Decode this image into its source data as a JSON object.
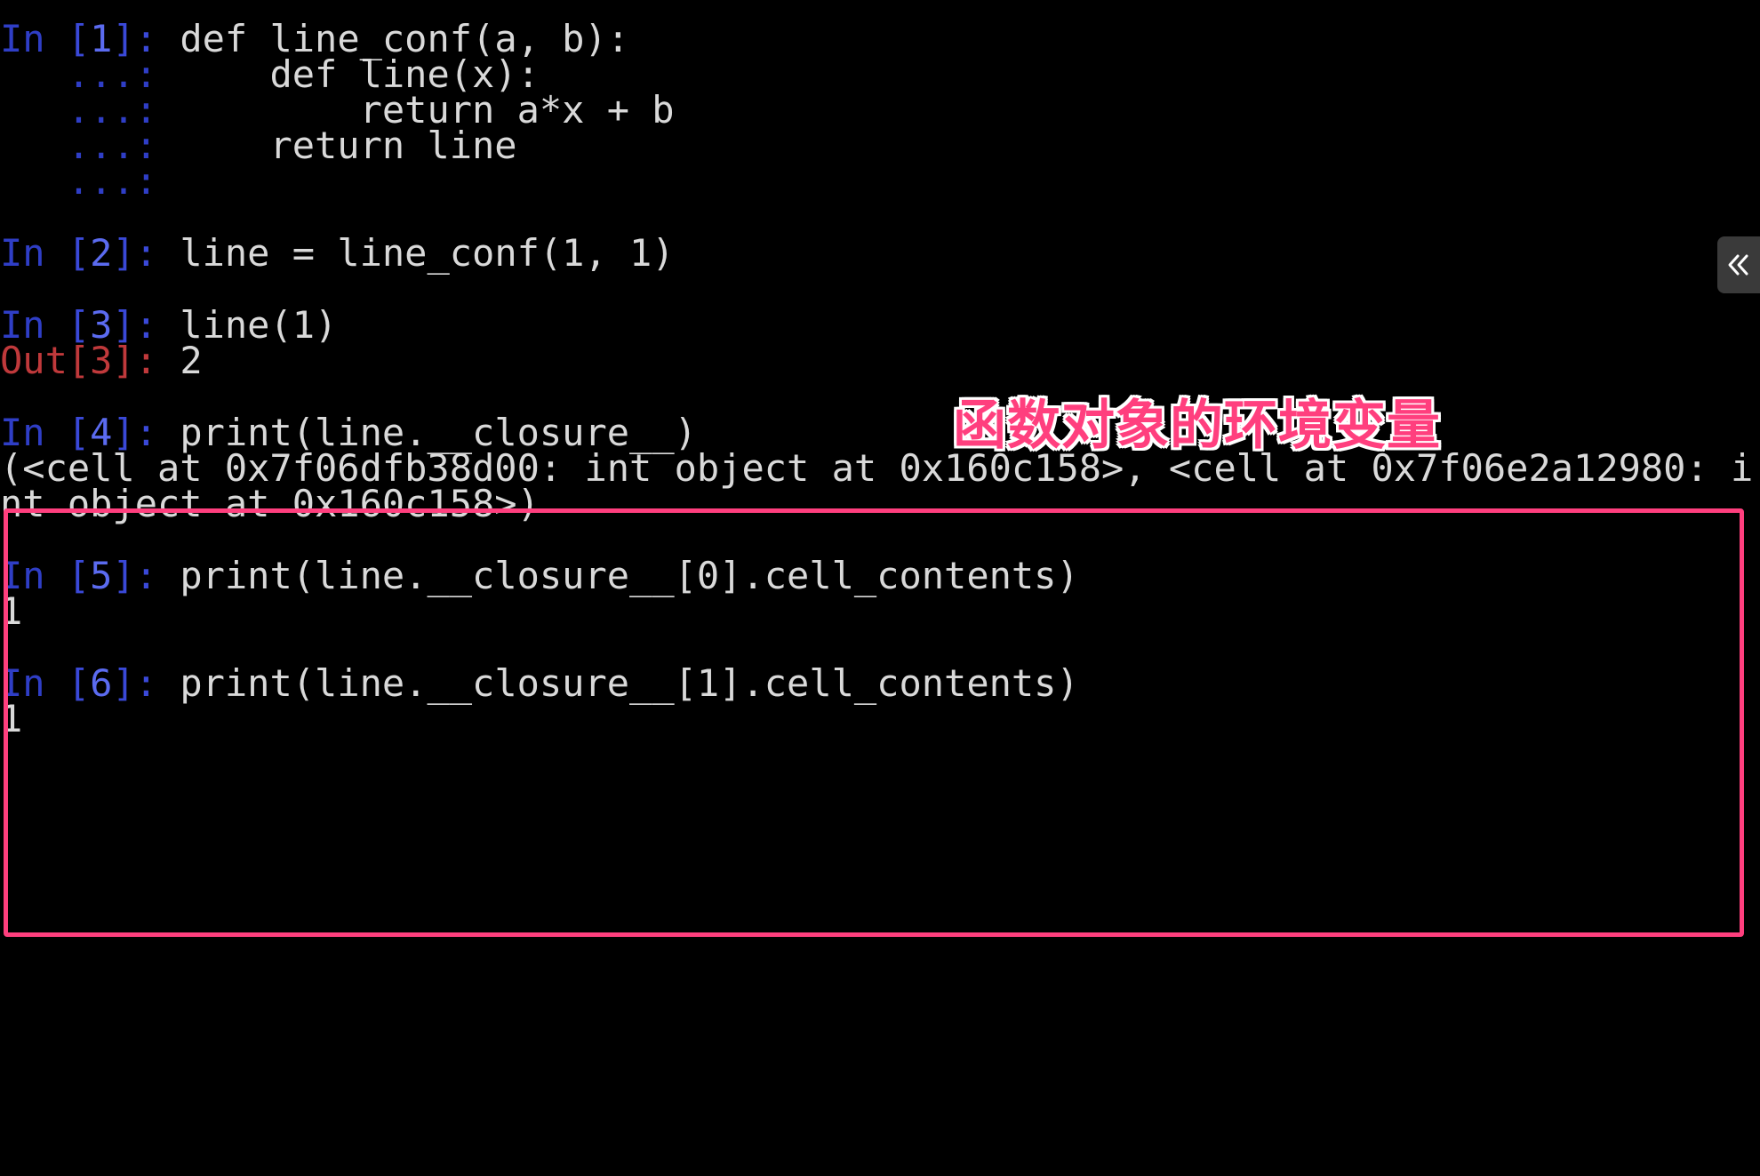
{
  "session": {
    "cells": [
      {
        "in_label": "In ",
        "num": "1",
        "lines": [
          "def line_conf(a, b):",
          "    def line(x):",
          "        return a*x + b",
          "    return line",
          ""
        ]
      },
      {
        "in_label": "In ",
        "num": "2",
        "lines": [
          "line = line_conf(1, 1)"
        ]
      },
      {
        "in_label": "In ",
        "num": "3",
        "lines": [
          "line(1)"
        ],
        "out_label": "Out",
        "out": "2"
      },
      {
        "in_label": "In ",
        "num": "4",
        "lines": [
          "print(line.__closure__)"
        ],
        "output": [
          "(<cell at 0x7f06dfb38d00: int object at 0x160c158>, <cell at 0x7f06e2a12980: i",
          "nt object at 0x160c158>)"
        ]
      },
      {
        "in_label": "In ",
        "num": "5",
        "lines": [
          "print(line.__closure__[0].cell_contents)"
        ],
        "output": [
          "1"
        ]
      },
      {
        "in_label": "In ",
        "num": "6",
        "lines": [
          "print(line.__closure__[1].cell_contents)"
        ],
        "output": [
          "1"
        ]
      }
    ],
    "continuation_prompt": "   ...: "
  },
  "annotation": {
    "label": "函数对象的环境变量",
    "color": "#ff3f7e"
  },
  "sidebar_toggle": {
    "icon": "double-chevron-left-icon"
  }
}
